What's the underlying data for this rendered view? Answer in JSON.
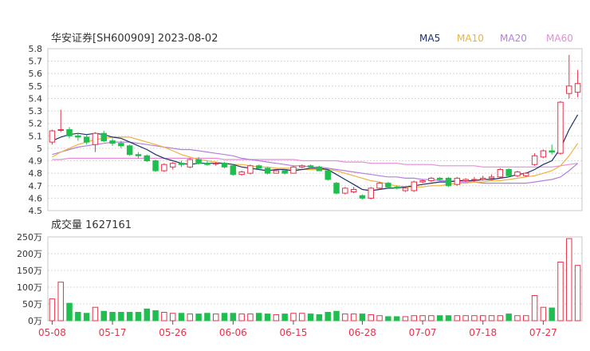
{
  "header": {
    "title": "华安证券[SH600909] 2023-08-02",
    "ma_legend": [
      {
        "label": "MA5",
        "color": "#1f2f6b"
      },
      {
        "label": "MA10",
        "color": "#f0b23c"
      },
      {
        "label": "MA20",
        "color": "#b47fe0"
      },
      {
        "label": "MA60",
        "color": "#e98bd6"
      }
    ]
  },
  "volume_header": {
    "label": "成交量",
    "value": "1627161"
  },
  "colors": {
    "up": "#e8324a",
    "down": "#1fbf4f",
    "grid": "#d8d8d8",
    "axis_text": "#333333"
  },
  "chart_data": [
    {
      "type": "candlestick",
      "ylim": [
        4.5,
        5.8
      ],
      "y_ticks": [
        "5.8",
        "5.7",
        "5.6",
        "5.5",
        "5.4",
        "5.3",
        "5.2",
        "5.1",
        "5",
        "4.9",
        "4.8",
        "4.7",
        "4.6",
        "4.5"
      ],
      "x_tick_labels": [
        "05-08",
        "05-17",
        "05-26",
        "06-06",
        "06-15",
        "06-28",
        "07-07",
        "07-18",
        "07-27"
      ],
      "x_tick_indices": [
        0,
        7,
        14,
        21,
        28,
        36,
        43,
        50,
        57
      ],
      "ohlc": [
        [
          5.05,
          5.14,
          5.03,
          5.15
        ],
        [
          5.15,
          5.15,
          5.13,
          5.31
        ],
        [
          5.15,
          5.1,
          5.08,
          5.17
        ],
        [
          5.1,
          5.09,
          5.06,
          5.12
        ],
        [
          5.09,
          5.05,
          5.03,
          5.11
        ],
        [
          5.03,
          5.12,
          4.97,
          5.13
        ],
        [
          5.12,
          5.06,
          5.05,
          5.14
        ],
        [
          5.06,
          5.04,
          5.02,
          5.08
        ],
        [
          5.04,
          5.02,
          5.0,
          5.06
        ],
        [
          5.02,
          4.95,
          4.94,
          5.03
        ],
        [
          4.95,
          4.94,
          4.92,
          4.97
        ],
        [
          4.94,
          4.9,
          4.89,
          4.95
        ],
        [
          4.9,
          4.82,
          4.81,
          4.91
        ],
        [
          4.82,
          4.87,
          4.81,
          4.88
        ],
        [
          4.85,
          4.88,
          4.83,
          4.89
        ],
        [
          4.88,
          4.87,
          4.85,
          4.9
        ],
        [
          4.85,
          4.91,
          4.84,
          4.92
        ],
        [
          4.91,
          4.88,
          4.87,
          4.93
        ],
        [
          4.88,
          4.87,
          4.86,
          4.9
        ],
        [
          4.88,
          4.88,
          4.86,
          4.89
        ],
        [
          4.88,
          4.85,
          4.84,
          4.89
        ],
        [
          4.86,
          4.79,
          4.78,
          4.87
        ],
        [
          4.79,
          4.81,
          4.78,
          4.82
        ],
        [
          4.8,
          4.86,
          4.79,
          4.87
        ],
        [
          4.86,
          4.84,
          4.83,
          4.87
        ],
        [
          4.84,
          4.8,
          4.79,
          4.85
        ],
        [
          4.8,
          4.82,
          4.8,
          4.83
        ],
        [
          4.82,
          4.8,
          4.79,
          4.83
        ],
        [
          4.8,
          4.85,
          4.8,
          4.86
        ],
        [
          4.85,
          4.86,
          4.84,
          4.87
        ],
        [
          4.86,
          4.85,
          4.84,
          4.87
        ],
        [
          4.85,
          4.82,
          4.82,
          4.86
        ],
        [
          4.82,
          4.75,
          4.74,
          4.83
        ],
        [
          4.72,
          4.64,
          4.63,
          4.73
        ],
        [
          4.64,
          4.68,
          4.63,
          4.69
        ],
        [
          4.65,
          4.67,
          4.64,
          4.69
        ],
        [
          4.62,
          4.6,
          4.59,
          4.63
        ],
        [
          4.6,
          4.68,
          4.59,
          4.69
        ],
        [
          4.68,
          4.72,
          4.67,
          4.73
        ],
        [
          4.72,
          4.69,
          4.68,
          4.73
        ],
        [
          4.69,
          4.68,
          4.67,
          4.7
        ],
        [
          4.66,
          4.68,
          4.65,
          4.69
        ],
        [
          4.66,
          4.73,
          4.65,
          4.74
        ],
        [
          4.73,
          4.74,
          4.72,
          4.75
        ],
        [
          4.74,
          4.76,
          4.73,
          4.77
        ],
        [
          4.76,
          4.75,
          4.74,
          4.77
        ],
        [
          4.76,
          4.7,
          4.69,
          4.77
        ],
        [
          4.71,
          4.76,
          4.7,
          4.77
        ],
        [
          4.74,
          4.75,
          4.73,
          4.76
        ],
        [
          4.75,
          4.75,
          4.73,
          4.77
        ],
        [
          4.75,
          4.76,
          4.74,
          4.78
        ],
        [
          4.76,
          4.77,
          4.75,
          4.79
        ],
        [
          4.77,
          4.83,
          4.76,
          4.84
        ],
        [
          4.83,
          4.78,
          4.77,
          4.84
        ],
        [
          4.78,
          4.81,
          4.77,
          4.82
        ],
        [
          4.78,
          4.8,
          4.77,
          4.81
        ],
        [
          4.87,
          4.94,
          4.86,
          4.96
        ],
        [
          4.93,
          4.98,
          4.92,
          4.99
        ],
        [
          4.98,
          4.97,
          4.95,
          5.03
        ],
        [
          4.96,
          5.37,
          4.95,
          5.38
        ],
        [
          5.44,
          5.5,
          5.4,
          5.75
        ],
        [
          5.45,
          5.52,
          5.41,
          5.63
        ]
      ],
      "ma5": [
        5.06,
        5.09,
        5.11,
        5.12,
        5.11,
        5.12,
        5.11,
        5.09,
        5.08,
        5.05,
        5.02,
        4.99,
        4.95,
        4.92,
        4.9,
        4.88,
        4.87,
        4.88,
        4.88,
        4.88,
        4.88,
        4.87,
        4.85,
        4.84,
        4.83,
        4.82,
        4.83,
        4.83,
        4.82,
        4.83,
        4.84,
        4.84,
        4.83,
        4.79,
        4.75,
        4.71,
        4.67,
        4.66,
        4.67,
        4.68,
        4.68,
        4.69,
        4.7,
        4.71,
        4.72,
        4.73,
        4.73,
        4.74,
        4.74,
        4.74,
        4.75,
        4.75,
        4.76,
        4.77,
        4.79,
        4.8,
        4.83,
        4.87,
        4.9,
        5.0,
        5.15,
        5.27
      ],
      "ma10": [
        4.93,
        4.97,
        5.0,
        5.03,
        5.05,
        5.07,
        5.08,
        5.09,
        5.09,
        5.09,
        5.07,
        5.05,
        5.03,
        5.01,
        4.98,
        4.95,
        4.93,
        4.91,
        4.9,
        4.89,
        4.88,
        4.87,
        4.87,
        4.86,
        4.85,
        4.85,
        4.84,
        4.84,
        4.84,
        4.83,
        4.83,
        4.83,
        4.83,
        4.82,
        4.8,
        4.78,
        4.76,
        4.74,
        4.73,
        4.71,
        4.7,
        4.69,
        4.69,
        4.69,
        4.7,
        4.7,
        4.71,
        4.72,
        4.72,
        4.73,
        4.73,
        4.74,
        4.74,
        4.75,
        4.76,
        4.77,
        4.78,
        4.8,
        4.82,
        4.86,
        4.94,
        5.04
      ],
      "ma20": [
        4.95,
        4.97,
        4.99,
        5.01,
        5.02,
        5.03,
        5.04,
        5.05,
        5.05,
        5.05,
        5.04,
        5.03,
        5.02,
        5.01,
        5.0,
        4.99,
        4.99,
        4.98,
        4.97,
        4.96,
        4.95,
        4.94,
        4.92,
        4.91,
        4.9,
        4.89,
        4.88,
        4.87,
        4.86,
        4.86,
        4.85,
        4.85,
        4.84,
        4.83,
        4.82,
        4.81,
        4.8,
        4.79,
        4.78,
        4.77,
        4.77,
        4.76,
        4.76,
        4.75,
        4.75,
        4.74,
        4.74,
        4.73,
        4.73,
        4.73,
        4.72,
        4.72,
        4.72,
        4.72,
        4.72,
        4.72,
        4.73,
        4.74,
        4.75,
        4.77,
        4.82,
        4.88
      ],
      "ma60": [
        4.91,
        4.91,
        4.92,
        4.92,
        4.92,
        4.92,
        4.92,
        4.92,
        4.92,
        4.92,
        4.92,
        4.92,
        4.92,
        4.92,
        4.92,
        4.92,
        4.92,
        4.92,
        4.92,
        4.92,
        4.91,
        4.91,
        4.91,
        4.91,
        4.91,
        4.91,
        4.91,
        4.91,
        4.91,
        4.9,
        4.9,
        4.9,
        4.9,
        4.9,
        4.89,
        4.89,
        4.89,
        4.88,
        4.88,
        4.88,
        4.88,
        4.87,
        4.87,
        4.87,
        4.87,
        4.86,
        4.86,
        4.86,
        4.86,
        4.86,
        4.85,
        4.85,
        4.85,
        4.85,
        4.85,
        4.85,
        4.85,
        4.85,
        4.85,
        4.86,
        4.87,
        4.88
      ]
    },
    {
      "type": "bar",
      "title": "成交量",
      "ylim": [
        0,
        250
      ],
      "y_ticks": [
        "250万",
        "200万",
        "150万",
        "100万",
        "50万",
        "0万"
      ],
      "values": [
        65,
        115,
        52,
        25,
        22,
        40,
        28,
        25,
        25,
        25,
        25,
        35,
        30,
        25,
        22,
        22,
        20,
        20,
        22,
        20,
        22,
        22,
        20,
        20,
        22,
        20,
        18,
        20,
        22,
        22,
        20,
        18,
        25,
        28,
        20,
        20,
        20,
        18,
        15,
        12,
        12,
        12,
        15,
        15,
        15,
        15,
        15,
        15,
        15,
        15,
        15,
        15,
        15,
        20,
        15,
        15,
        75,
        40,
        38,
        175,
        245,
        165
      ]
    }
  ]
}
